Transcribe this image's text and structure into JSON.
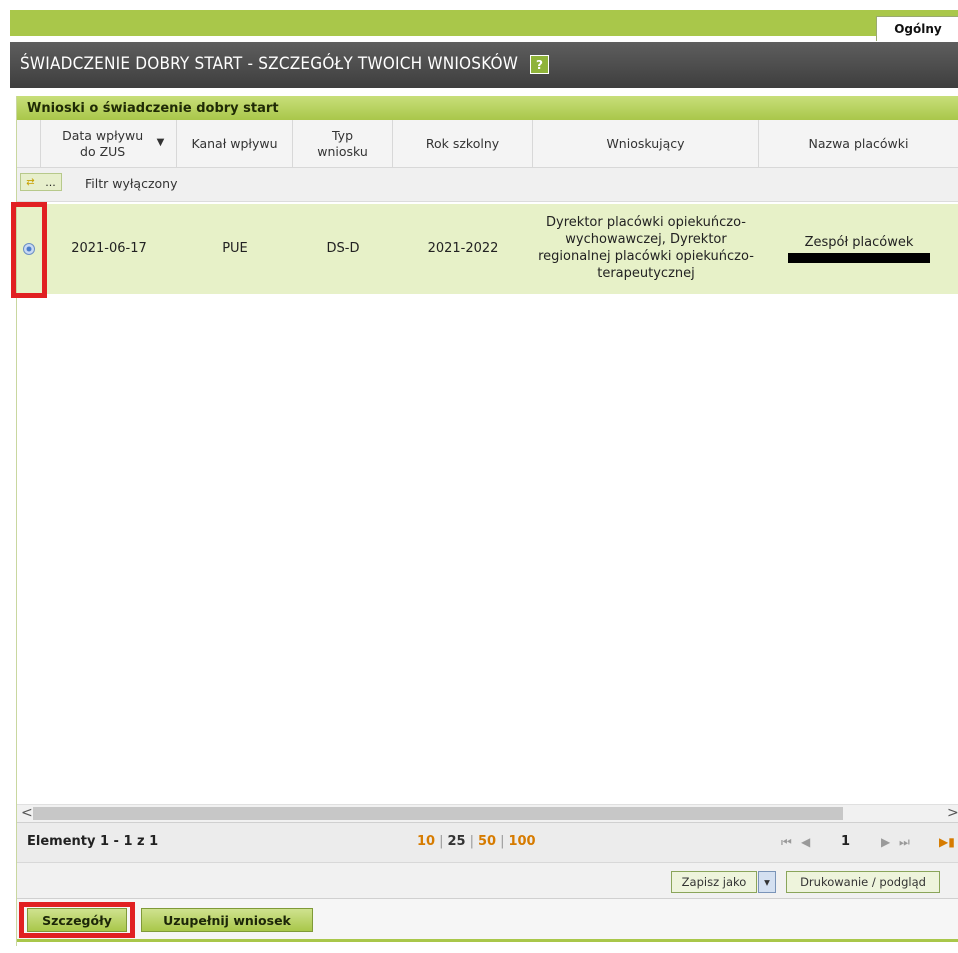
{
  "tabs": {
    "general_label": "Ogólny"
  },
  "header": {
    "title": "ŚWIADCZENIE DOBRY START - SZCZEGÓŁY TWOICH WNIOSKÓW",
    "help_icon": "?"
  },
  "panel": {
    "title": "Wnioski o świadczenie dobry start"
  },
  "table": {
    "columns": [
      "Data wpływu do ZUS",
      "Kanał wpływu",
      "Typ wniosku",
      "Rok szkolny",
      "Wnioskujący",
      "Nazwa placówki"
    ],
    "sorted_column_indicator": "▼",
    "filter_button_label": "...",
    "filter_status": "Filtr wyłączony",
    "rows": [
      {
        "date": "2021-06-17",
        "channel": "PUE",
        "type": "DS-D",
        "school_year": "2021-2022",
        "applicant": "Dyrektor placówki opiekuńczo-wychowawczej, Dyrektor regionalnej placówki opiekuńczo-terapeutycznej",
        "facility": "Zespół placówek",
        "selected": true
      }
    ]
  },
  "pager": {
    "info": "Elementy 1 - 1 z 1",
    "page_sizes": [
      "10",
      "25",
      "50",
      "100"
    ],
    "active_page_size": "25",
    "current_page": "1"
  },
  "export": {
    "save_as": "Zapisz jako",
    "print_preview": "Drukowanie / podgląd"
  },
  "actions": {
    "details": "Szczegóły",
    "complete": "Uzupełnij wniosek"
  },
  "colors": {
    "accent": "#a9c74a",
    "selected_row": "#e7f1c8",
    "highlight": "#e12022",
    "header_bg": "#4a4a4a"
  }
}
